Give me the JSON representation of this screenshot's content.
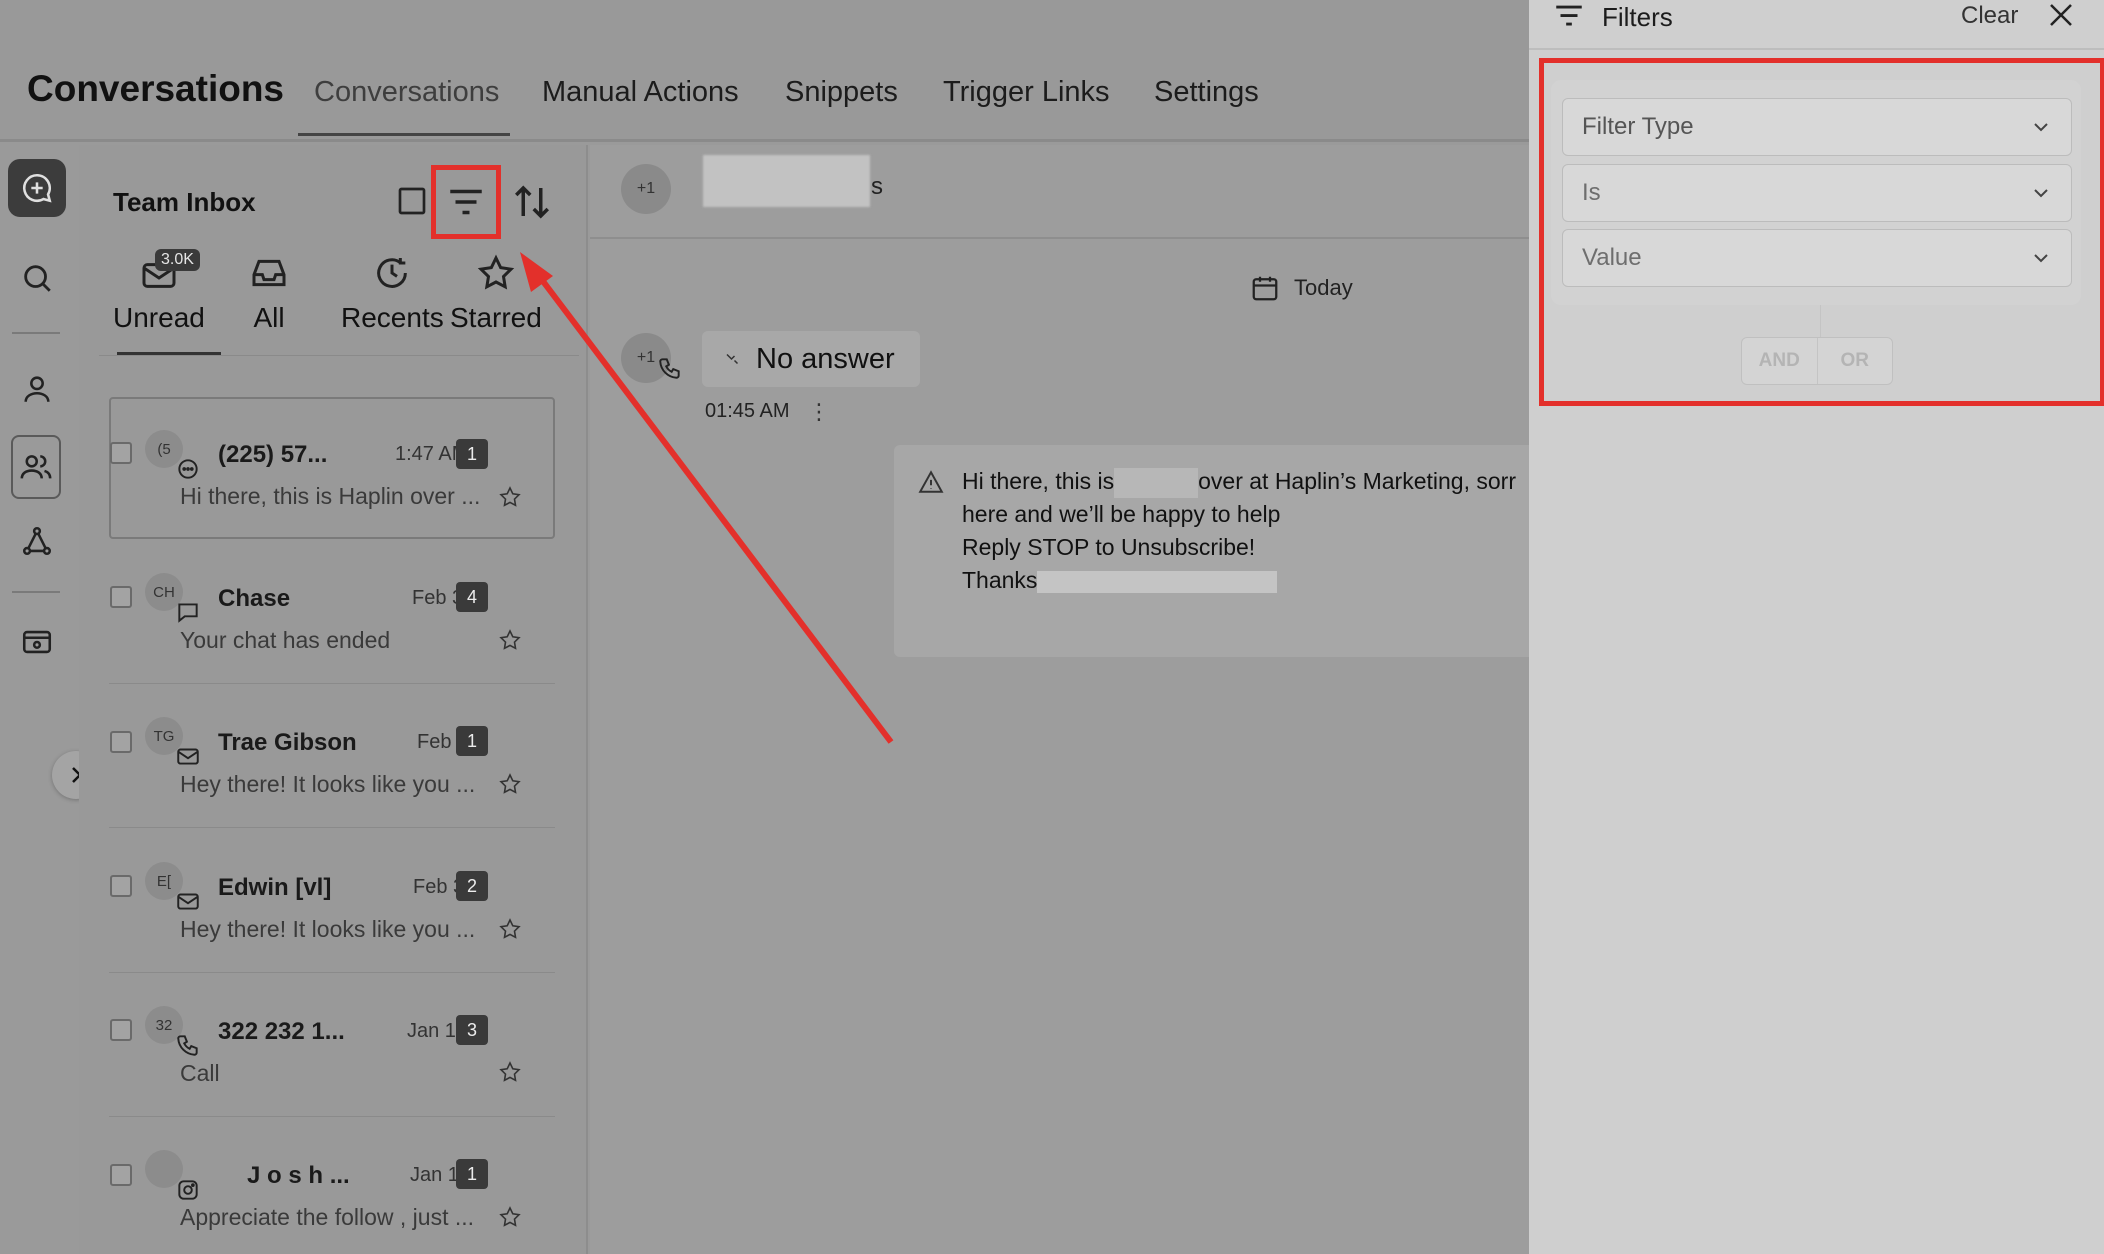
{
  "header": {
    "app_title": "Conversations",
    "tabs": [
      "Conversations",
      "Manual Actions",
      "Snippets",
      "Trigger Links",
      "Settings"
    ]
  },
  "inbox": {
    "title": "Team Inbox",
    "tabs": [
      {
        "label": "Unread",
        "badge": "3.0K"
      },
      {
        "label": "All"
      },
      {
        "label": "Recents"
      },
      {
        "label": "Starred"
      }
    ],
    "conversations": [
      {
        "avatar": "(5",
        "name": "(225) 57...",
        "time": "1:47 AM",
        "count": "1",
        "preview": "Hi there, this is Haplin over ...",
        "channel": "chat"
      },
      {
        "avatar": "CH",
        "name": "Chase",
        "time": "Feb 3",
        "count": "4",
        "preview": "Your chat has ended",
        "channel": "livechat"
      },
      {
        "avatar": "TG",
        "name": "Trae Gibson",
        "time": "Feb 3",
        "count": "1",
        "preview": "Hey there!  It looks like you ...",
        "channel": "email"
      },
      {
        "avatar": "E[",
        "name": "Edwin [vl]",
        "time": "Feb 3",
        "count": "2",
        "preview": "Hey there!  It looks like you ...",
        "channel": "email"
      },
      {
        "avatar": "32",
        "name": "322 232 1...",
        "time": "Jan 17",
        "count": "3",
        "preview": "Call",
        "channel": "phone"
      },
      {
        "avatar": "",
        "name": "J o s h ...",
        "time": "Jan 16",
        "count": "1",
        "preview": "Appreciate the follow , just ...",
        "channel": "instagram"
      }
    ]
  },
  "chat": {
    "avatar_label": "+1",
    "header_suffix": "s",
    "date_label": "Today",
    "call_status": "No answer",
    "call_time": "01:45 AM",
    "message_lines": [
      {
        "before": "Hi there, this is",
        "after": "over at Haplin’s Marketing, sorr"
      },
      {
        "before": "here and we’ll be happy to help",
        "after": ""
      },
      {
        "before": "Reply STOP to Unsubscribe!",
        "after": ""
      },
      {
        "before": "Thanks",
        "after": ""
      }
    ]
  },
  "filters": {
    "title": "Filters",
    "clear_label": "Clear",
    "selects": [
      {
        "placeholder": "Filter Type"
      },
      {
        "placeholder": "Is"
      },
      {
        "placeholder": "Value"
      }
    ],
    "logic": [
      "AND",
      "OR"
    ]
  },
  "colors": {
    "highlight": "#e3302b",
    "badge": "#3a3a3a"
  }
}
